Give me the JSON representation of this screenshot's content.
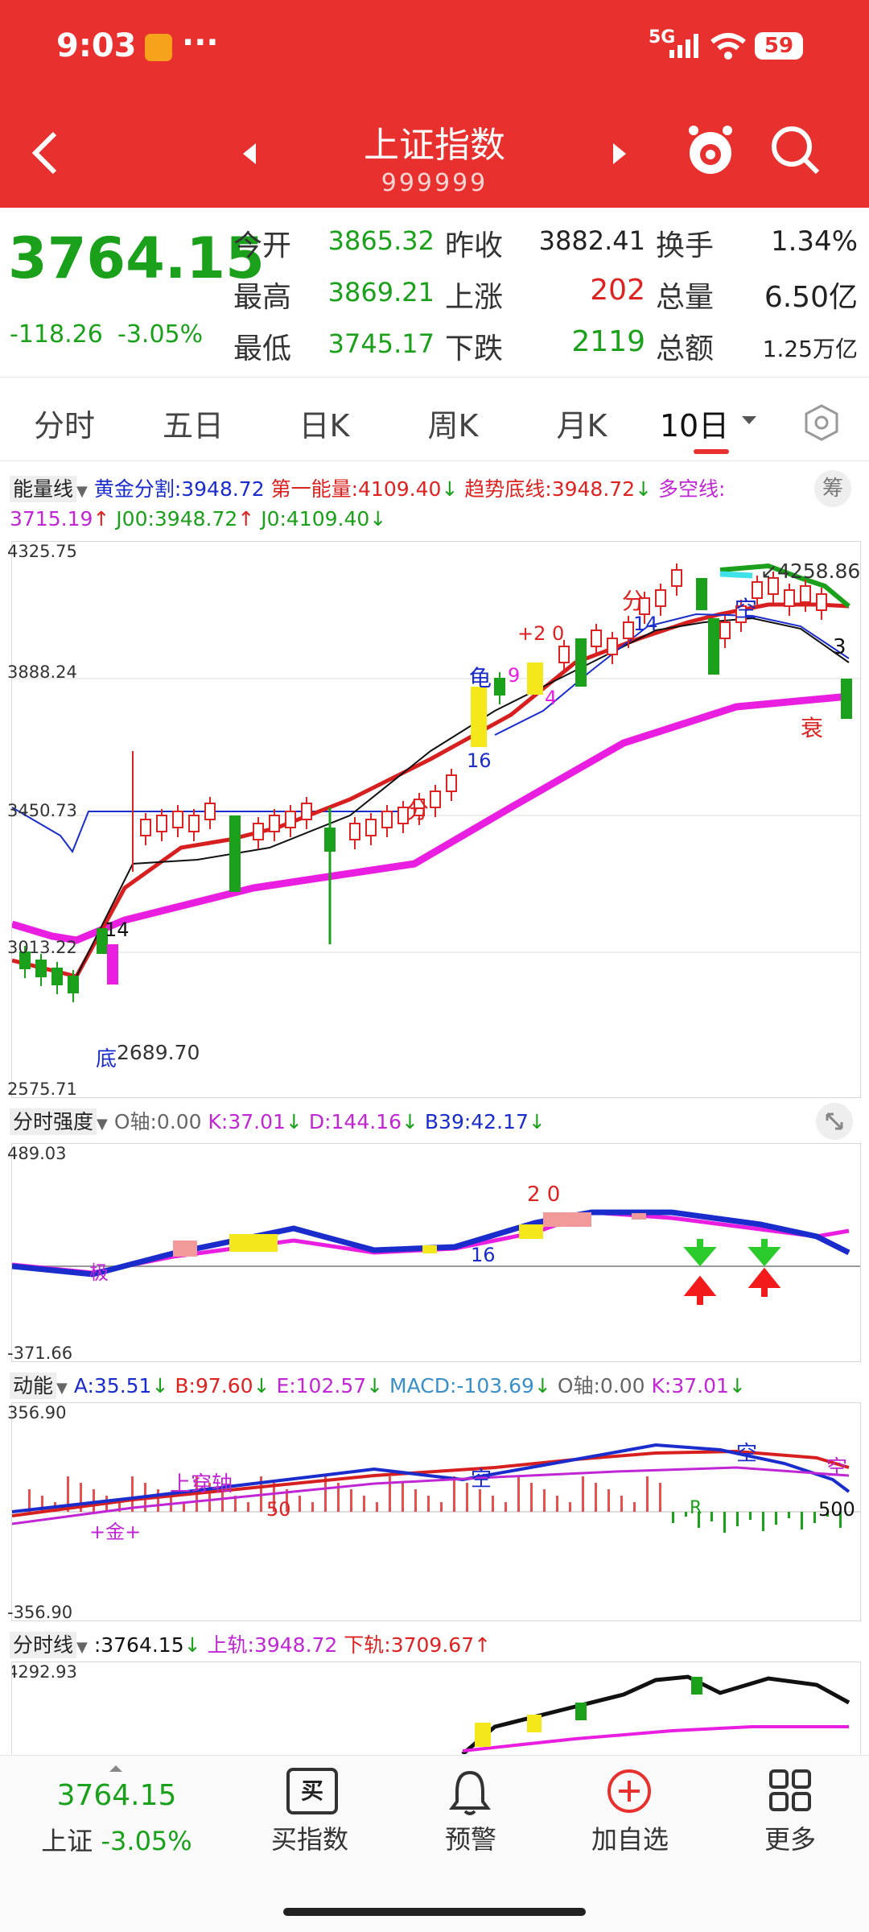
{
  "status": {
    "time": "9:03",
    "dots": "···",
    "net": "5G",
    "battery": "59"
  },
  "header": {
    "title": "上证指数",
    "code": "999999"
  },
  "quote": {
    "price": "3764.15",
    "change": "-118.26",
    "pct": "-3.05%",
    "open_label": "今开",
    "open": "3865.32",
    "prev_label": "昨收",
    "prev": "3882.41",
    "turnover_label": "换手",
    "turnover": "1.34%",
    "high_label": "最高",
    "high": "3869.21",
    "up_label": "上涨",
    "up": "202",
    "volume_label": "总量",
    "volume": "6.50亿",
    "low_label": "最低",
    "low": "3745.17",
    "down_label": "下跌",
    "down": "2119",
    "amount_label": "总额",
    "amount": "1.25万亿"
  },
  "tabs": [
    "分时",
    "五日",
    "日K",
    "周K",
    "月K",
    "10日"
  ],
  "main_ind": {
    "name": "能量线",
    "a": "黄金分割:3948.72",
    "b": "第一能量:4109.40",
    "c": "趋势底线:3948.72",
    "d": "多空线:",
    "e": "3715.19",
    "f": "J00:3948.72",
    "g": "J0:4109.40",
    "chou": "筹"
  },
  "main_axis": {
    "y1": "4325.75",
    "y2": "3888.24",
    "y3": "3450.73",
    "y4": "3013.22",
    "y5": "2575.71"
  },
  "main_labels": {
    "high": "4258.86",
    "low": "2689.70",
    "n14": "14",
    "n16": "16",
    "n20": "+2 0",
    "fen": "分",
    "kong": "空",
    "shuai": "衰",
    "gui": "龟",
    "n9": "9",
    "n4": "4",
    "n13": "3",
    "di": "底",
    "fen2": "分",
    "n14b": "14"
  },
  "strength": {
    "name": "分时强度",
    "o": "O轴:0.00",
    "k": "K:37.01",
    "d": "D:144.16",
    "b": "B39:42.17",
    "top": "489.03",
    "bot": "-371.66",
    "n20": "2 0",
    "n16": "16",
    "ji": "极"
  },
  "momentum": {
    "name": "动能",
    "a": "A:35.51",
    "b": "B:97.60",
    "e": "E:102.57",
    "macd": "MACD:-103.69",
    "o": "O轴:0.00",
    "k": "K:37.01",
    "top": "356.90",
    "bot": "-356.90",
    "shang": "上穿轴",
    "kong": "空",
    "jin": "+金+",
    "n50": "50",
    "n500": "500",
    "r": "R"
  },
  "timeline": {
    "name": "分时线",
    "v": ":3764.15",
    "up": "上轨:3948.72",
    "dn": "下轨:3709.67",
    "top": "4292.93"
  },
  "bottom": {
    "price": "3764.15",
    "name": "上证",
    "pct": "-3.05%",
    "buy": "买指数",
    "buy_icon": "买",
    "alert": "预警",
    "add": "加自选",
    "more": "更多"
  },
  "colors": {
    "red": "#e8312f",
    "green": "#1aa01a",
    "magenta": "#e91ee0",
    "blue": "#1a2ccc"
  }
}
